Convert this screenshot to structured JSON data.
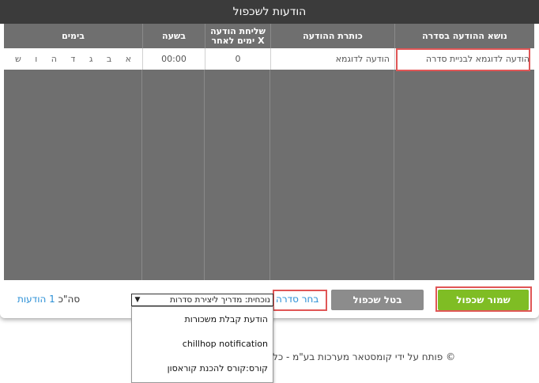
{
  "modal": {
    "title": "הודעות לשכפול"
  },
  "table": {
    "headers": {
      "subject": "נושא ההודעה בסדרה",
      "heading": "כותרת ההודעה",
      "send_after_line1": "שליחת הודעה",
      "send_after_line2": "X ימים לאחר",
      "time": "בשעה",
      "days": "בימים"
    },
    "row": {
      "subject": "הודעה לדוגמא לבניית סדרה",
      "heading": "הודעה לדוגמא",
      "send_after": "0",
      "time": "00:00",
      "days": [
        "א",
        "ב",
        "ג",
        "ד",
        "ה",
        "ו",
        "ש"
      ]
    }
  },
  "footer": {
    "save_label": "שמור שכפול",
    "cancel_label": "בטל שכפול",
    "choose_series_label": "בחר סדרה",
    "select_value": "נוכחית: מדריך ליצירת סדרות",
    "total_prefix": "סה\"כ",
    "total_count": "1",
    "total_unit": "הודעות"
  },
  "dropdown": {
    "options": [
      "הודעת קבלת משכורות",
      "chillhop notification",
      "קורס:קורס להכנת קוראסון"
    ]
  },
  "page": {
    "copyright": "© פותח על ידי קומסטאר מערכות בע\"מ - כל"
  },
  "colors": {
    "header_bg": "#3b3b3b",
    "save": "#7fbd24",
    "cancel": "#8c8c8c",
    "link": "#2a8fd6",
    "highlight": "#e05656"
  }
}
